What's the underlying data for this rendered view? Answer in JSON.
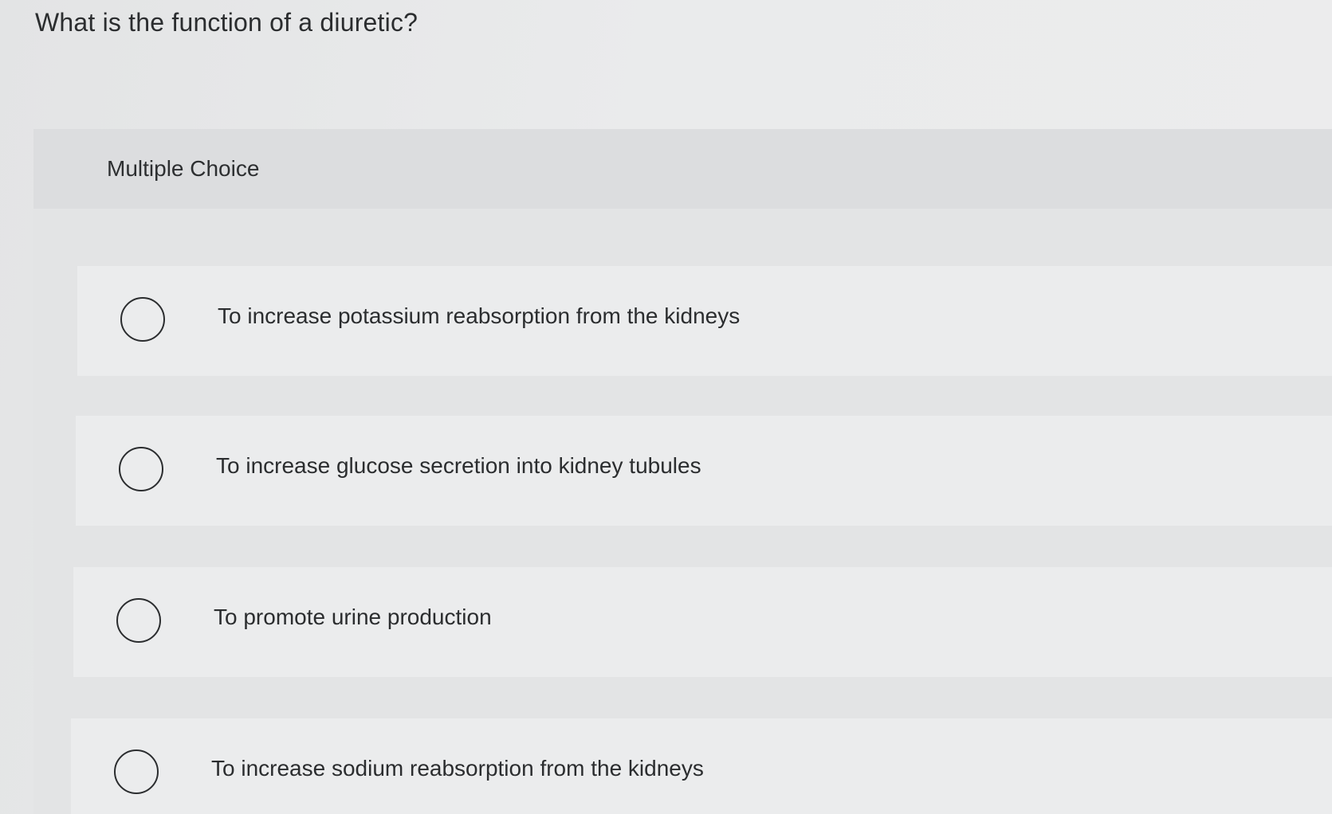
{
  "question": {
    "text": "What is the function of a diuretic?"
  },
  "panel": {
    "header_label": "Multiple Choice"
  },
  "options": [
    {
      "label": "To increase potassium reabsorption from the kidneys",
      "selected": false
    },
    {
      "label": "To increase glucose secretion into kidney tubules",
      "selected": false
    },
    {
      "label": "To promote urine production",
      "selected": false
    },
    {
      "label": "To increase sodium reabsorption from the kidneys",
      "selected": false
    }
  ]
}
